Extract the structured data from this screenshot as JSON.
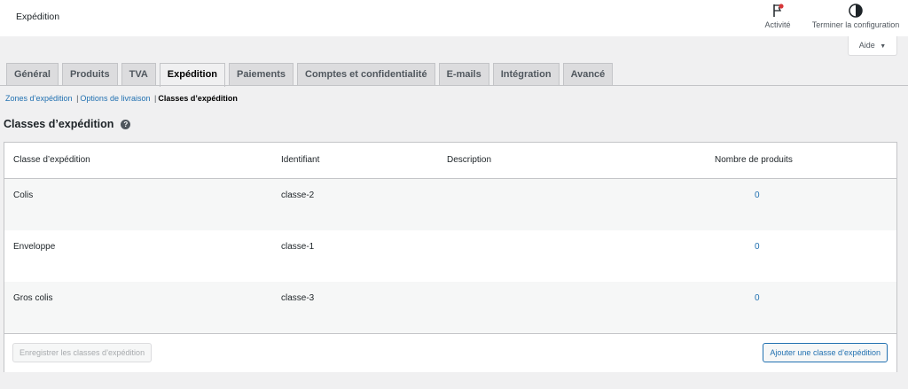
{
  "header": {
    "title": "Expédition",
    "actions": [
      {
        "label": "Activité",
        "icon": "flag-icon"
      },
      {
        "label": "Terminer la configuration",
        "icon": "half-circle-icon"
      }
    ],
    "help_label": "Aide",
    "help_arrow": "▼"
  },
  "tabs": [
    {
      "label": "Général",
      "active": false
    },
    {
      "label": "Produits",
      "active": false
    },
    {
      "label": "TVA",
      "active": false
    },
    {
      "label": "Expédition",
      "active": true
    },
    {
      "label": "Paiements",
      "active": false
    },
    {
      "label": "Comptes et confidentialité",
      "active": false
    },
    {
      "label": "E-mails",
      "active": false
    },
    {
      "label": "Intégration",
      "active": false
    },
    {
      "label": "Avancé",
      "active": false
    }
  ],
  "subnav": {
    "items": [
      "Zones d’expédition",
      "Options de livraison",
      "Classes d’expédition"
    ],
    "separator": "|",
    "current_index": 2
  },
  "page": {
    "heading": "Classes d’expédition",
    "help_glyph": "?"
  },
  "table": {
    "columns": [
      "Classe d’expédition",
      "Identifiant",
      "Description",
      "Nombre de produits"
    ],
    "rows": [
      {
        "name": "Colis",
        "slug": "classe-2",
        "description": "",
        "count": "0"
      },
      {
        "name": "Enveloppe",
        "slug": "classe-1",
        "description": "",
        "count": "0"
      },
      {
        "name": "Gros colis",
        "slug": "classe-3",
        "description": "",
        "count": "0"
      }
    ],
    "save_label": "Enregistrer les classes d’expédition",
    "add_label": "Ajouter une classe d’expédition"
  },
  "colors": {
    "link": "#2271b1",
    "background": "#f0f0f1",
    "tab_inactive": "#dcdcde",
    "activity_dot": "#d63638"
  }
}
